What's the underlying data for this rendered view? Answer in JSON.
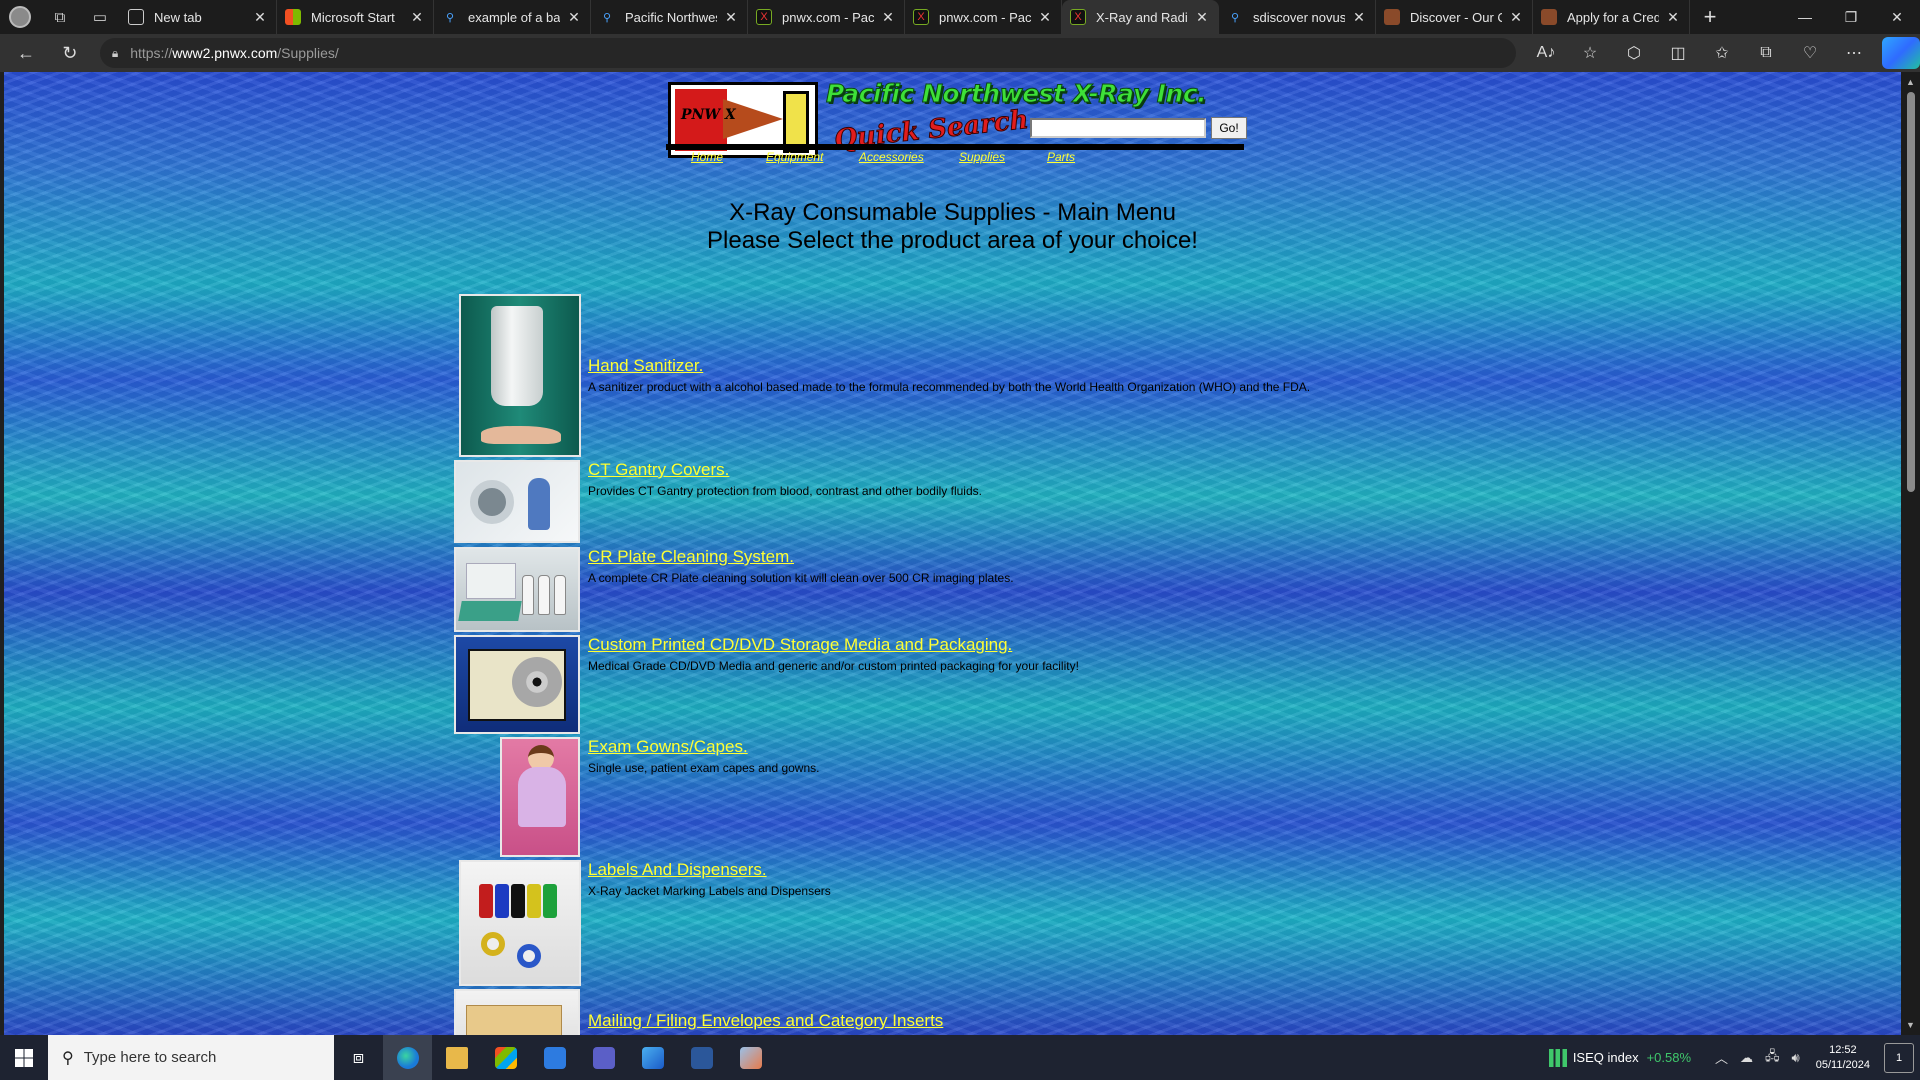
{
  "browser": {
    "tabs": [
      {
        "title": "New tab",
        "favicon": "page-icon",
        "active": false
      },
      {
        "title": "Microsoft Start",
        "favicon": "microsoft-icon",
        "active": false
      },
      {
        "title": "example of a bad",
        "favicon": "search-icon",
        "active": false
      },
      {
        "title": "Pacific Northwest",
        "favicon": "search-icon",
        "active": false
      },
      {
        "title": "pnwx.com - Pacific",
        "favicon": "pnwx-icon",
        "active": false
      },
      {
        "title": "pnwx.com - Pacific",
        "favicon": "pnwx-icon",
        "active": false
      },
      {
        "title": "X-Ray and Radiolo",
        "favicon": "pnwx-icon",
        "active": true
      },
      {
        "title": "sdiscover novus -",
        "favicon": "search-icon",
        "active": false
      },
      {
        "title": "Discover - Our Co",
        "favicon": "discover-icon",
        "active": false
      },
      {
        "title": "Apply for a Credit",
        "favicon": "discover-icon",
        "active": false
      }
    ],
    "url_prefix": "https://",
    "url_host": "www2.pnwx.com",
    "url_path": "/Supplies/"
  },
  "site": {
    "name": "Pacific Northwest X-Ray Inc.",
    "logo_text": "PNW X",
    "quick_search_label": "Quick Search",
    "search_value": "",
    "go_label": "Go!",
    "nav": [
      "Home",
      "Equipment",
      "Accessories",
      "Supplies",
      "Parts"
    ]
  },
  "heading": {
    "line1": "X-Ray Consumable Supplies - Main Menu",
    "line2": "Please Select the product area of your choice!"
  },
  "products": [
    {
      "title": "Hand Sanitizer.",
      "desc": "A sanitizer product with a alcohol based made to the formula recommended by both the World Health Organization (WHO) and the FDA."
    },
    {
      "title": "CT Gantry Covers.",
      "desc": "Provides CT Gantry protection from blood, contrast and other bodily fluids."
    },
    {
      "title": "CR Plate Cleaning System.",
      "desc": "A complete CR Plate cleaning solution kit will clean over 500 CR imaging plates."
    },
    {
      "title": "Custom Printed CD/DVD Storage Media and Packaging.",
      "desc": "Medical Grade CD/DVD Media and generic and/or custom printed packaging for your facility!"
    },
    {
      "title": "Exam Gowns/Capes.",
      "desc": "Single use, patient exam capes and gowns."
    },
    {
      "title": "Labels And Dispensers.",
      "desc": "X-Ray Jacket Marking Labels and Dispensers"
    },
    {
      "title": "Mailing / Filing Envelopes and Category Inserts",
      "desc": ""
    }
  ],
  "taskbar": {
    "search_placeholder": "Type here to search",
    "widget_label": "ISEQ index",
    "widget_change": "+0.58%",
    "time": "12:52",
    "date": "05/11/2024",
    "notification_count": "1"
  },
  "colors": {
    "link": "#ffff33",
    "site_name": "#3ee038",
    "quick_search": "#e11d1d"
  }
}
